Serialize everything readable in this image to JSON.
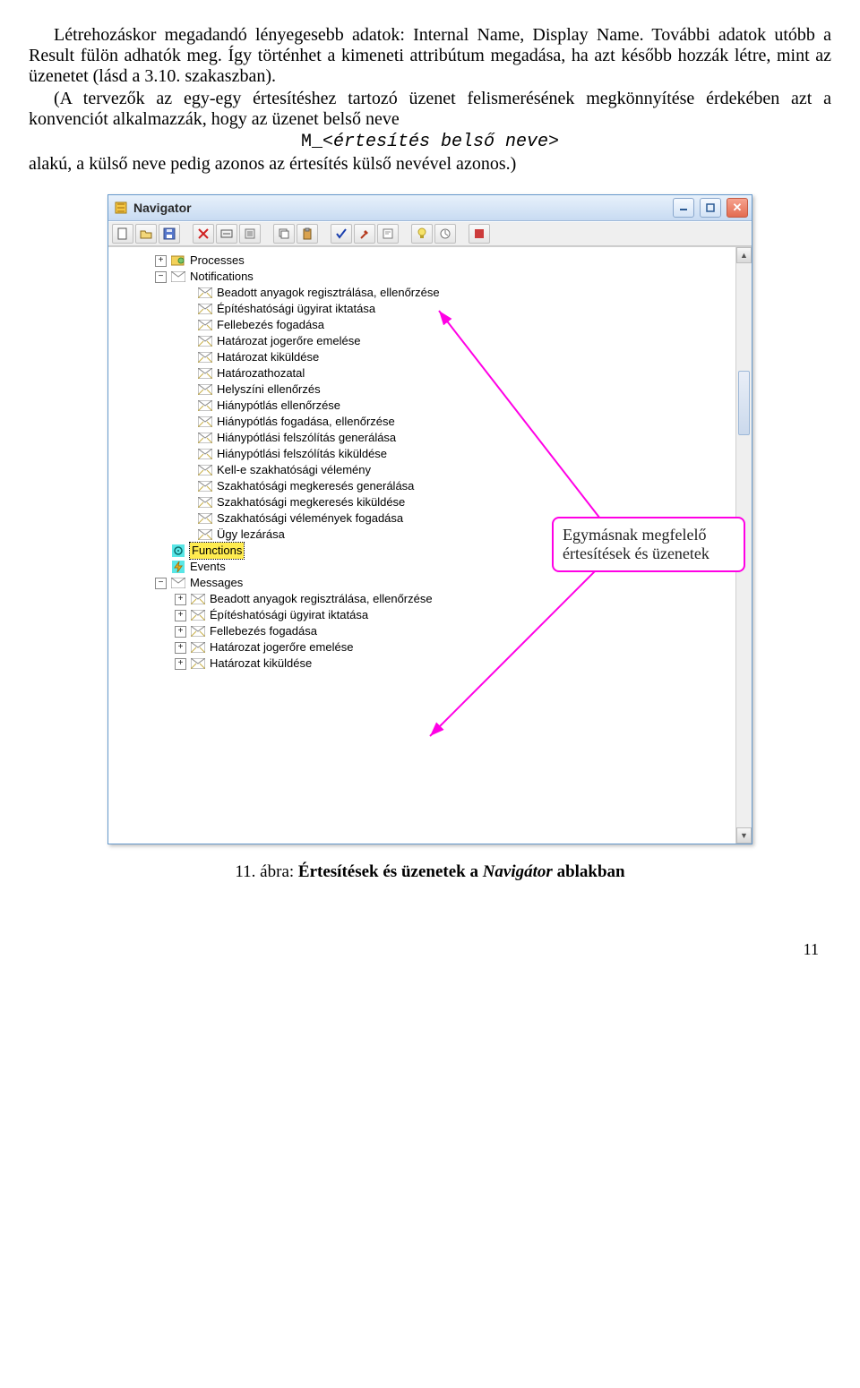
{
  "text": {
    "p1": "Létrehozáskor megadandó lényegesebb adatok: Internal Name, Display Name. További adatok utóbb a Result fülön adhatók meg. Így történhet a kimeneti attribútum megadása, ha azt később hozzák létre, mint az üzenetet (lásd a 3.10. szakaszban).",
    "p2": "(A tervezők az egy-egy értesítéshez tartozó üzenet felismerésének megkönnyítése érdekében azt a konvenciót alkalmazzák, hogy az üzenet belső neve",
    "formula_pre": "M_",
    "formula_ital": "<értesítés belső neve>",
    "p3": "alakú, a külső neve pedig azonos az értesítés külső nevével azonos.)"
  },
  "window": {
    "title": "Navigator",
    "tree": {
      "processes": {
        "label": "Processes",
        "exp": "+"
      },
      "notifications": {
        "label": "Notifications",
        "exp": "−",
        "items": [
          "Beadott anyagok regisztrálása, ellenőrzése",
          "Építéshatósági ügyirat iktatása",
          "Fellebezés fogadása",
          "Határozat jogerőre emelése",
          "Határozat kiküldése",
          "Határozathozatal",
          "Helyszíni ellenőrzés",
          "Hiánypótlás ellenőrzése",
          "Hiánypótlás fogadása, ellenőrzése",
          "Hiánypótlási felszólítás generálása",
          "Hiánypótlási felszólítás kiküldése",
          "Kell-e szakhatósági vélemény",
          "Szakhatósági megkeresés generálása",
          "Szakhatósági megkeresés kiküldése",
          "Szakhatósági vélemények fogadása",
          "Ügy lezárása"
        ]
      },
      "functions": {
        "label": "Functions"
      },
      "events": {
        "label": "Events"
      },
      "messages": {
        "label": "Messages",
        "exp": "−",
        "items": [
          "Beadott anyagok regisztrálása, ellenőrzése",
          "Építéshatósági ügyirat iktatása",
          "Fellebezés fogadása",
          "Határozat jogerőre emelése",
          "Határozat kiküldése"
        ]
      }
    }
  },
  "callout": "Egymásnak megfelelő értesítések és üzenetek",
  "caption_num": "11. ábra: ",
  "caption_rest1": "Értesítések és üzenetek a ",
  "caption_rest2": "Navigátor",
  "caption_rest3": " ablakban",
  "pagenum": "11"
}
